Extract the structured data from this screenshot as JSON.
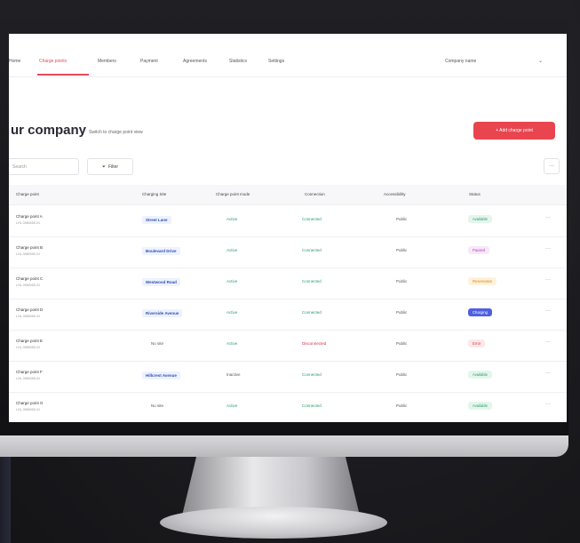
{
  "nav": {
    "tabs": [
      {
        "label": "Home"
      },
      {
        "label": "Charge points"
      },
      {
        "label": "Members"
      },
      {
        "label": "Payment"
      },
      {
        "label": "Agreements"
      },
      {
        "label": "Statistics"
      },
      {
        "label": "Settings"
      }
    ],
    "active_tab": "Charge points",
    "company_select": {
      "value": "Company name"
    }
  },
  "header": {
    "title": "ur company",
    "subtitle": "Switch to charge point view",
    "add_button": "+ Add charge point"
  },
  "toolbar": {
    "search_placeholder": "Search",
    "filter_label": "Filter",
    "more": "···"
  },
  "table": {
    "columns": [
      "Charge point",
      "Charging Site",
      "Charge point mode",
      "Connection",
      "Accessibility",
      "Status"
    ],
    "rows": [
      {
        "name": "Charge point A",
        "id": "LHL-3980055.24",
        "site": "Street Lane",
        "site_pill": true,
        "mode": "Active",
        "connection": "Connected",
        "access": "Public",
        "status": "Available",
        "status_kind": "available"
      },
      {
        "name": "Charge point B",
        "id": "LHL-3980055.24",
        "site": "Boulevard Drive",
        "site_pill": true,
        "mode": "Active",
        "connection": "Connected",
        "access": "Public",
        "status": "Paused",
        "status_kind": "paused"
      },
      {
        "name": "Charge point C",
        "id": "LHL-3980055.24",
        "site": "Westwood Road",
        "site_pill": true,
        "mode": "Active",
        "connection": "Connected",
        "access": "Public",
        "status": "Reservation",
        "status_kind": "reservation"
      },
      {
        "name": "Charge point D",
        "id": "LHL-3980055.24",
        "site": "Riverside Avenue",
        "site_pill": true,
        "mode": "Active",
        "connection": "Connected",
        "access": "Public",
        "status": "Charging",
        "status_kind": "charging"
      },
      {
        "name": "Charge point E",
        "id": "LHL-3980055.24",
        "site": "No site",
        "site_pill": false,
        "mode": "Active",
        "connection": "Disconnected",
        "access": "Public",
        "status": "Error",
        "status_kind": "error"
      },
      {
        "name": "Charge point F",
        "id": "LHL-3980055.24",
        "site": "Hillcrest Avenue",
        "site_pill": true,
        "mode": "Inactive",
        "connection": "Connected",
        "access": "Public",
        "status": "Available",
        "status_kind": "available"
      },
      {
        "name": "Charge point G",
        "id": "LHL-3980055.24",
        "site": "No site",
        "site_pill": false,
        "mode": "Active",
        "connection": "Connected",
        "access": "Public",
        "status": "Available",
        "status_kind": "available"
      }
    ],
    "row_more": "···"
  },
  "colors": {
    "accent": "#e8454f",
    "available": "#2c9a6c",
    "charging": "#4f5fe0"
  }
}
